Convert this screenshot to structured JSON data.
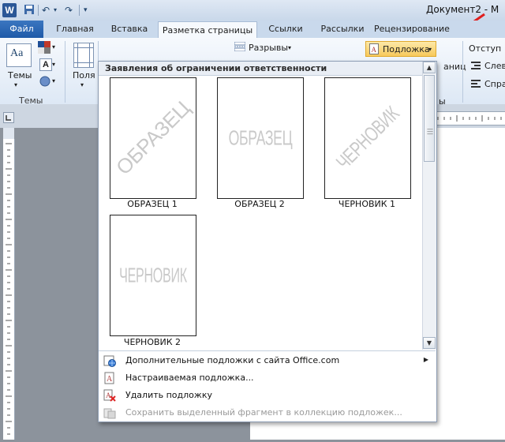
{
  "window": {
    "title": "Документ2 - M"
  },
  "tabs": {
    "file": "Файл",
    "home": "Главная",
    "insert": "Вставка",
    "page_layout": "Разметка страницы",
    "references": "Ссылки",
    "mailings": "Рассылки",
    "review": "Рецензирование"
  },
  "ribbon": {
    "themes": {
      "button": "Темы",
      "group": "Темы"
    },
    "margins": {
      "button": "Поля"
    },
    "breaks": {
      "label": "Разрывы"
    },
    "watermark": {
      "label": "Подложка"
    },
    "paragraph": {
      "indent": "Отступ",
      "left_short": "Слев",
      "right_short": "Спра",
      "group_tail": "ы",
      "spacing_tail": "аниц"
    }
  },
  "gallery": {
    "section_title": "Заявления об ограничении ответственности",
    "items": [
      {
        "caption": "ОБРАЗЕЦ 1",
        "watermark_text": "ОБРАЗЕЦ",
        "orientation": "diagonal"
      },
      {
        "caption": "ОБРАЗЕЦ 2",
        "watermark_text": "ОБРАЗЕЦ",
        "orientation": "horizontal"
      },
      {
        "caption": "ЧЕРНОВИК 1",
        "watermark_text": "ЧЕРНОВИК",
        "orientation": "diagonal"
      },
      {
        "caption": "ЧЕРНОВИК 2",
        "watermark_text": "ЧЕРНОВИК",
        "orientation": "horizontal"
      }
    ]
  },
  "menu": {
    "more_online": {
      "label": "Дополнительные подложки с сайта Office.com",
      "icon": "office-globe-icon"
    },
    "custom": {
      "label": "Настраиваемая подложка...",
      "icon": "custom-watermark-icon"
    },
    "remove": {
      "label": "Удалить подложку",
      "icon": "remove-watermark-icon"
    },
    "save_selection": {
      "label": "Сохранить выделенный фрагмент в коллекцию подложек...",
      "icon": "save-gallery-icon",
      "disabled": true
    }
  },
  "colors": {
    "accent_arrow": "#e01e1e",
    "highlight": "#f7c95b",
    "file_tab": "#2b5797"
  }
}
